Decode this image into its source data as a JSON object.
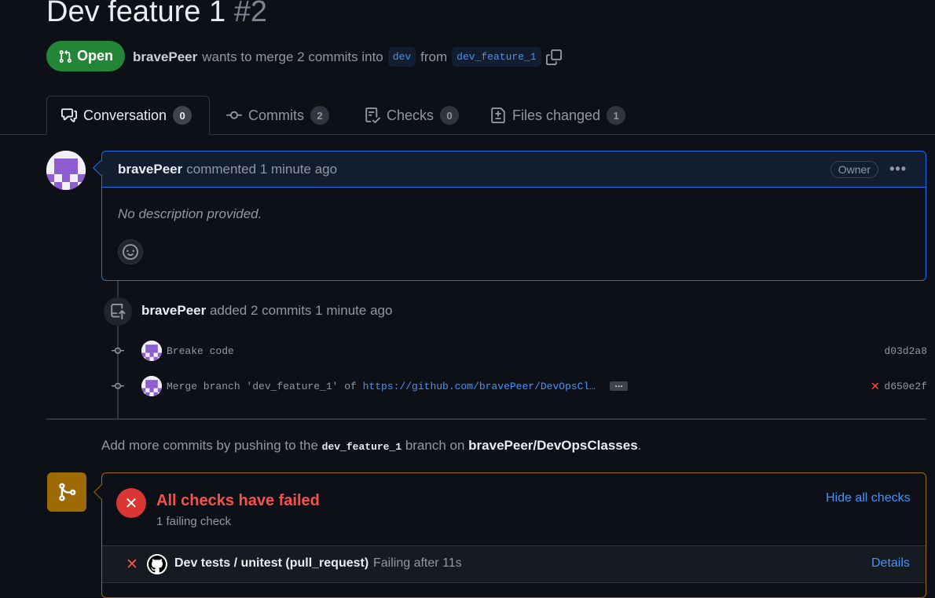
{
  "pr": {
    "title": "Dev feature 1",
    "number": "#2",
    "state": "Open",
    "author": "bravePeer",
    "merge_text": "wants to merge 2 commits into",
    "base_branch": "dev",
    "from_text": "from",
    "head_branch": "dev_feature_1"
  },
  "tabs": [
    {
      "label": "Conversation",
      "count": "0",
      "icon": "comment-discussion-icon"
    },
    {
      "label": "Commits",
      "count": "2",
      "icon": "git-commit-icon"
    },
    {
      "label": "Checks",
      "count": "0",
      "icon": "checklist-icon"
    },
    {
      "label": "Files changed",
      "count": "1",
      "icon": "file-diff-icon"
    }
  ],
  "comment": {
    "author": "bravePeer",
    "meta": "commented 1 minute ago",
    "badge": "Owner",
    "menu": "•••",
    "body": "No description provided."
  },
  "timeline_event": {
    "author": "bravePeer",
    "text": "added 2 commits 1 minute ago"
  },
  "commits": [
    {
      "message": "Breake code",
      "link": "",
      "sha": "d03d2a8",
      "failed": false
    },
    {
      "message": "Merge branch 'dev_feature_1' of ",
      "link": "https://github.com/bravePeer/DevOpsCl…",
      "sha": "d650e2f",
      "failed": true
    }
  ],
  "push_hint": {
    "prefix": "Add more commits by pushing to the",
    "branch": "dev_feature_1",
    "middle": "branch on",
    "repo": "bravePeer/DevOpsClasses",
    "suffix": "."
  },
  "checks": {
    "title": "All checks have failed",
    "subtitle": "1 failing check",
    "toggle_label": "Hide all checks",
    "items": [
      {
        "name": "Dev tests / unitest (pull_request)",
        "status": "Failing after 11s",
        "action": "Details"
      }
    ]
  },
  "colors": {
    "open_green": "#238636",
    "link_blue": "#4493f8",
    "fail_red": "#f85149",
    "warning_amber": "#9e6a03"
  }
}
